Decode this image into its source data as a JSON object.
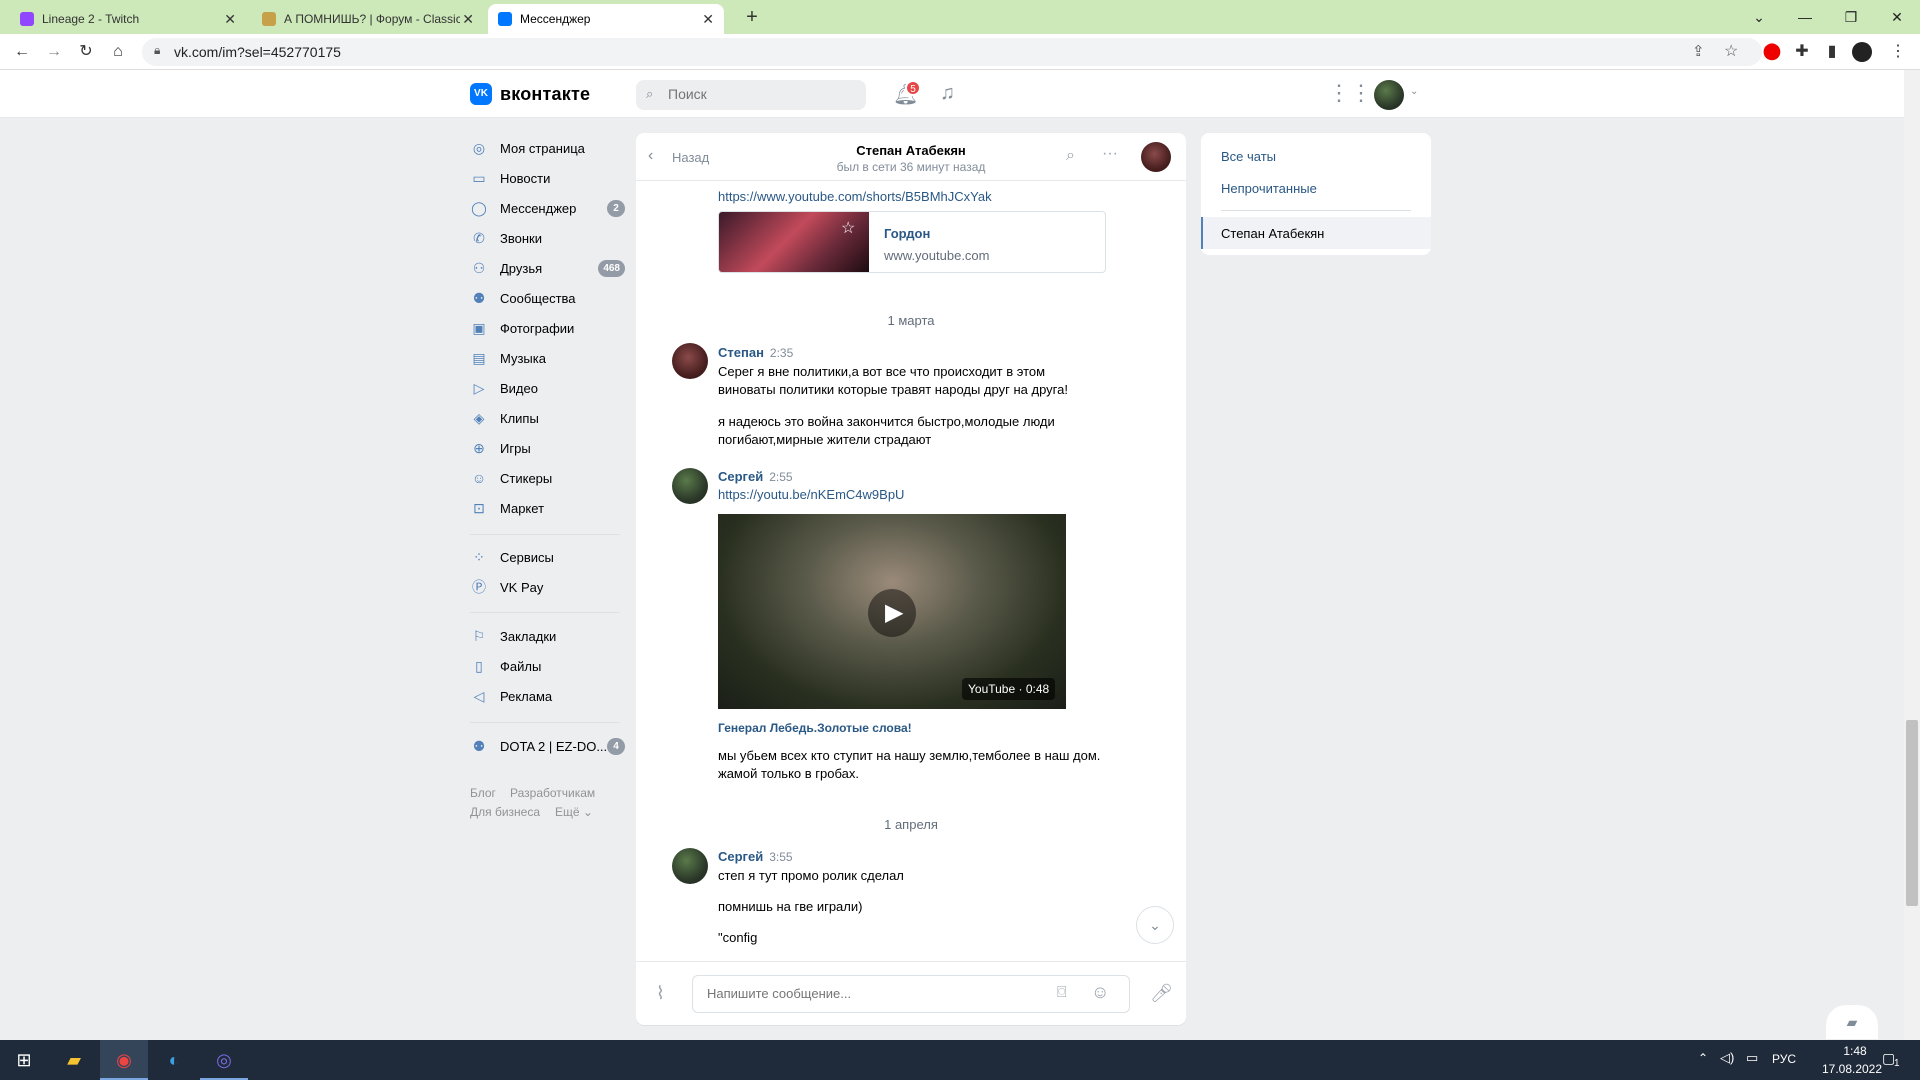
{
  "browser": {
    "tabs": [
      {
        "title": "Lineage 2 - Twitch",
        "icon_color": "#9146ff"
      },
      {
        "title": "А ПОМНИШЬ? | Форум - Classic",
        "icon_color": "#c7a04a"
      },
      {
        "title": "Мессенджер",
        "icon_color": "#0077ff"
      }
    ],
    "new_tab": "+",
    "url": "vk.com/im?sel=452770175"
  },
  "vk": {
    "brand": "вконтакте",
    "logo_letter": "VK",
    "search_placeholder": "Поиск",
    "notifications_count": "5",
    "nav": [
      {
        "label": "Моя страница",
        "icon": "user-circle-icon"
      },
      {
        "label": "Новости",
        "icon": "newspaper-icon"
      },
      {
        "label": "Мессенджер",
        "icon": "message-icon",
        "badge": "2"
      },
      {
        "label": "Звонки",
        "icon": "phone-icon"
      },
      {
        "label": "Друзья",
        "icon": "friends-icon",
        "badge": "468"
      },
      {
        "label": "Сообщества",
        "icon": "community-icon"
      },
      {
        "label": "Фотографии",
        "icon": "photo-icon"
      },
      {
        "label": "Музыка",
        "icon": "music-icon"
      },
      {
        "label": "Видео",
        "icon": "video-icon"
      },
      {
        "label": "Клипы",
        "icon": "clips-icon"
      },
      {
        "label": "Игры",
        "icon": "gamepad-icon"
      },
      {
        "label": "Стикеры",
        "icon": "smile-icon"
      },
      {
        "label": "Маркет",
        "icon": "bag-icon"
      }
    ],
    "nav2": [
      {
        "label": "Сервисы",
        "icon": "services-icon"
      },
      {
        "label": "VK Pay",
        "icon": "vkpay-icon"
      }
    ],
    "nav3": [
      {
        "label": "Закладки",
        "icon": "bookmark-icon"
      },
      {
        "label": "Файлы",
        "icon": "file-icon"
      },
      {
        "label": "Реклама",
        "icon": "megaphone-icon"
      }
    ],
    "group": {
      "label": "DOTA 2 | EZ-DO...",
      "badge": "4"
    },
    "footer": [
      "Блог",
      "Разработчикам",
      "Для бизнеса",
      "Ещё ⌄"
    ]
  },
  "chat": {
    "back_label": "Назад",
    "contact_name": "Степан Атабекян",
    "last_seen": "был в сети 36 минут назад",
    "link_top": "https://www.youtube.com/shorts/B5BMhJCxYak",
    "card_title": "Гордон",
    "card_domain": "www.youtube.com",
    "date1": "1 марта",
    "msg1": {
      "sender": "Степан",
      "time": "2:35",
      "lines": [
        "Серег я вне политики,а вот все что происходит в этом",
        "виноваты политики которые травят народы друг на друга!"
      ],
      "lines2": [
        "я надеюсь это война закончится быстро,молодые люди",
        "погибают,мирные жители страдают"
      ]
    },
    "msg2": {
      "sender": "Сергей",
      "time": "2:55",
      "link": "https://youtu.be/nKEmC4w9BpU",
      "video_badge": "YouTube · 0:48",
      "video_title": "Генерал Лебедь.Золотые слова!",
      "lines": [
        "мы убьем всех кто ступит на нашу землю,темболее в наш дом.",
        "жамой только в гробах."
      ]
    },
    "date2": "1 апреля",
    "msg3": {
      "sender": "Сергей",
      "time": "3:55",
      "line1": "степ я тут промо ролик сделал",
      "line2": "помнишь на гве играли)",
      "line3": "\"config"
    },
    "composer_placeholder": "Напишите сообщение..."
  },
  "right": {
    "all_chats": "Все чаты",
    "unread": "Непрочитанные",
    "active": "Степан Атабекян"
  },
  "taskbar": {
    "lang": "РУС",
    "time": "1:48",
    "date": "17.08.2022",
    "notif": "1"
  }
}
